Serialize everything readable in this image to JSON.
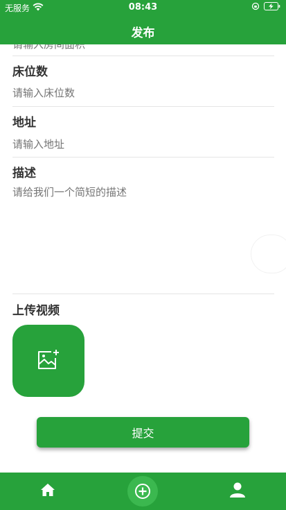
{
  "status_bar": {
    "carrier": "无服务",
    "time": "08:43"
  },
  "header": {
    "title": "发布"
  },
  "form": {
    "area_placeholder": "请输入房间面积",
    "beds_label": "床位数",
    "beds_placeholder": "请输入床位数",
    "address_label": "地址",
    "address_placeholder": "请输入地址",
    "description_label": "描述",
    "description_placeholder": "请给我们一个简短的描述",
    "video_label": "上传视频",
    "submit_label": "提交"
  },
  "tabbar": {
    "items": [
      {
        "icon": "home-icon"
      },
      {
        "icon": "add-icon"
      },
      {
        "icon": "user-icon"
      }
    ]
  },
  "colors": {
    "primary": "#27a23b",
    "primary_light": "#3bb84f"
  }
}
